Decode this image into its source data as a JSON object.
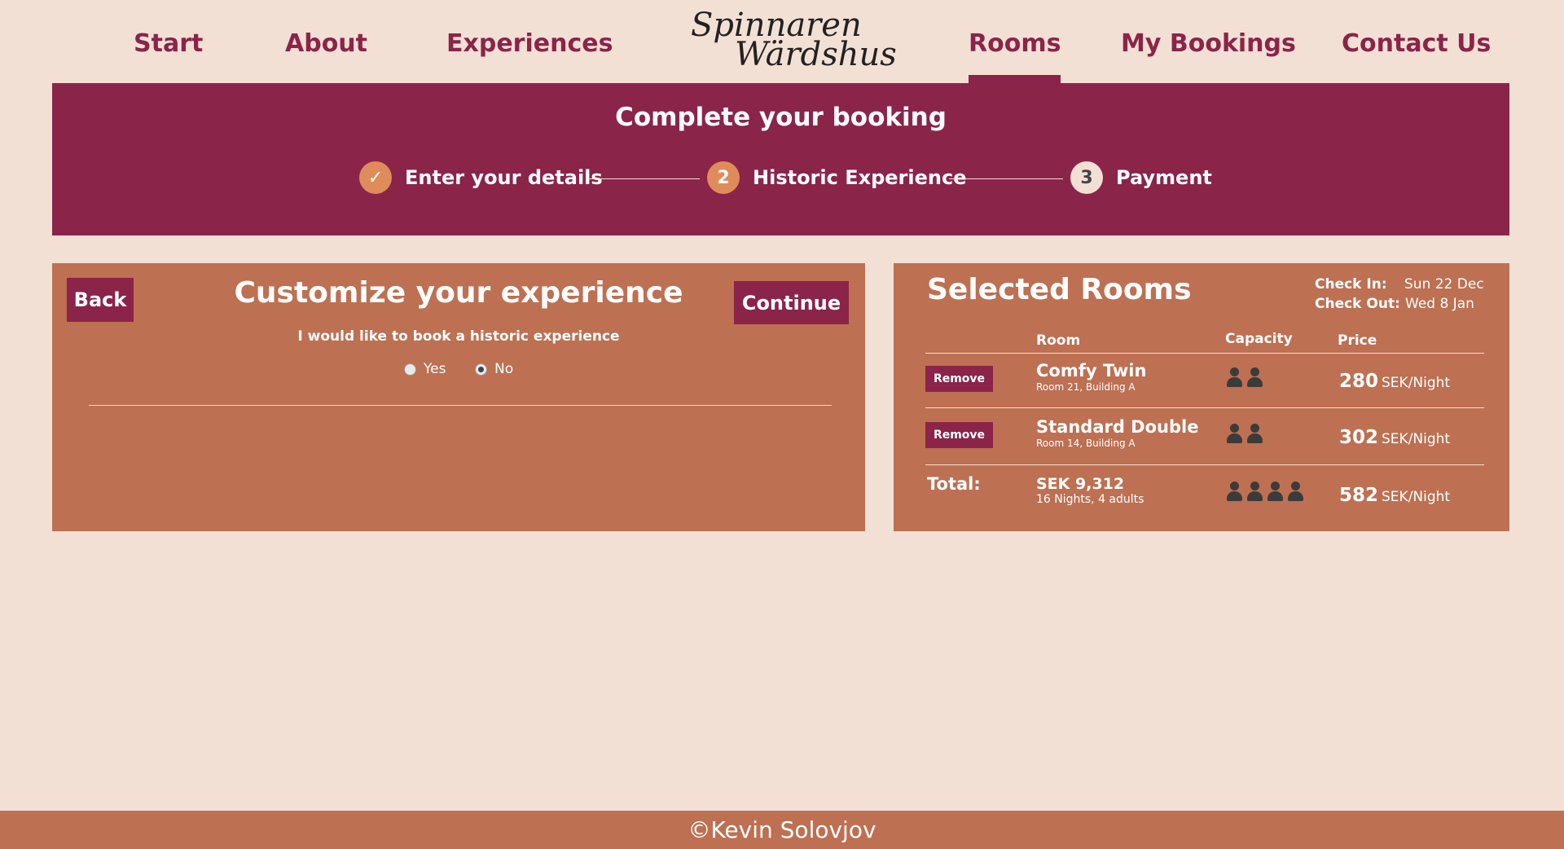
{
  "nav": {
    "items": [
      {
        "label": "Start"
      },
      {
        "label": "About"
      },
      {
        "label": "Experiences"
      },
      {
        "label": "Rooms",
        "active": true
      },
      {
        "label": "My Bookings"
      },
      {
        "label": "Contact Us"
      }
    ],
    "logo": {
      "line1": "Spinnaren",
      "line2": "Wärdshus"
    }
  },
  "progress": {
    "title": "Complete your booking",
    "steps": [
      {
        "marker": "✓",
        "label": "Enter your details",
        "state": "done",
        "icon": "check-icon"
      },
      {
        "marker": "2",
        "label": "Historic Experience",
        "state": "active"
      },
      {
        "marker": "3",
        "label": "Payment",
        "state": "pending"
      }
    ]
  },
  "experience": {
    "back_label": "Back",
    "title": "Customize your experience",
    "continue_label": "Continue",
    "question": "I would like to book a historic experience",
    "options": [
      {
        "label": "Yes",
        "checked": false
      },
      {
        "label": "No",
        "checked": true
      }
    ]
  },
  "selected_rooms": {
    "title": "Selected Rooms",
    "check_in_label": "Check In:",
    "check_in_value": "Sun 22 Dec",
    "check_out_label": "Check Out:",
    "check_out_value": "Wed 8 Jan",
    "columns": {
      "room": "Room",
      "capacity": "Capacity",
      "price": "Price"
    },
    "rooms": [
      {
        "remove_label": "Remove",
        "name": "Comfy Twin",
        "location": "Room 21, Building A",
        "capacity": 2,
        "price": "280",
        "unit": "SEK/Night"
      },
      {
        "remove_label": "Remove",
        "name": "Standard Double",
        "location": "Room 14, Building A",
        "capacity": 2,
        "price": "302",
        "unit": "SEK/Night"
      }
    ],
    "total": {
      "label": "Total:",
      "amount": "SEK 9,312",
      "details": "16 Nights, 4 adults",
      "capacity": 4,
      "price": "582",
      "unit": "SEK/Night"
    }
  },
  "footer": {
    "text": "©Kevin Solovjov"
  },
  "colors": {
    "primary": "#8b2449",
    "panel": "#bd7052",
    "background": "#f3e0d5",
    "accent": "#e08b5a"
  }
}
